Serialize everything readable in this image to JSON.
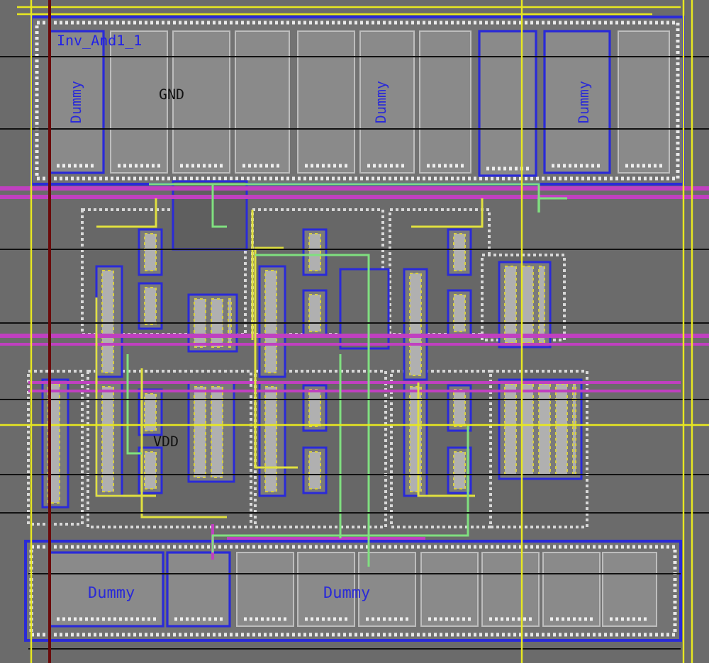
{
  "cell_name": "Inv_And1_1",
  "net_labels": [
    {
      "text": "GND",
      "kind": "ground"
    },
    {
      "text": "VDD",
      "kind": "supply"
    }
  ],
  "dummy_labels": [
    {
      "text": "Dummy",
      "kind": "vertical"
    },
    {
      "text": "Dummy",
      "kind": "vertical"
    },
    {
      "text": "Dummy",
      "kind": "vertical"
    },
    {
      "text": "Dummy",
      "kind": "horizontal"
    },
    {
      "text": "Dummy",
      "kind": "horizontal"
    }
  ]
}
